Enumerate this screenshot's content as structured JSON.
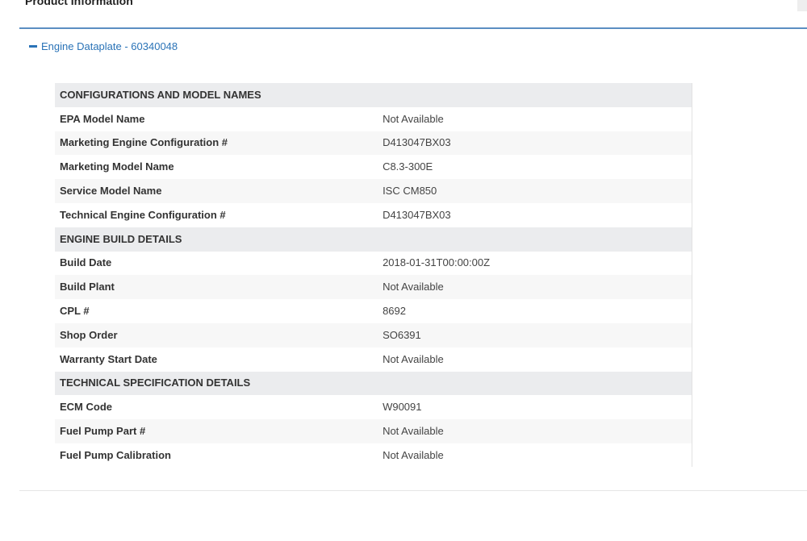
{
  "page": {
    "title": "Product Information"
  },
  "accordion": {
    "label": "Engine Dataplate - 60340048",
    "expanded": true,
    "accent_color": "#2a73b7"
  },
  "sections": [
    {
      "heading": "CONFIGURATIONS AND MODEL NAMES",
      "rows": [
        {
          "label": "EPA Model Name",
          "value": "Not Available"
        },
        {
          "label": "Marketing Engine Configuration #",
          "value": "D413047BX03"
        },
        {
          "label": "Marketing Model Name",
          "value": "C8.3-300E"
        },
        {
          "label": "Service Model Name",
          "value": "ISC CM850"
        },
        {
          "label": "Technical Engine Configuration #",
          "value": "D413047BX03"
        }
      ]
    },
    {
      "heading": "ENGINE BUILD DETAILS",
      "rows": [
        {
          "label": "Build Date",
          "value": "2018-01-31T00:00:00Z"
        },
        {
          "label": "Build Plant",
          "value": "Not Available"
        },
        {
          "label": "CPL #",
          "value": "8692"
        },
        {
          "label": "Shop Order",
          "value": "SO6391"
        },
        {
          "label": "Warranty Start Date",
          "value": "Not Available"
        }
      ]
    },
    {
      "heading": "TECHNICAL SPECIFICATION DETAILS",
      "rows": [
        {
          "label": "ECM Code",
          "value": "W90091"
        },
        {
          "label": "Fuel Pump Part #",
          "value": "Not Available"
        },
        {
          "label": "Fuel Pump Calibration",
          "value": "Not Available"
        }
      ]
    }
  ]
}
